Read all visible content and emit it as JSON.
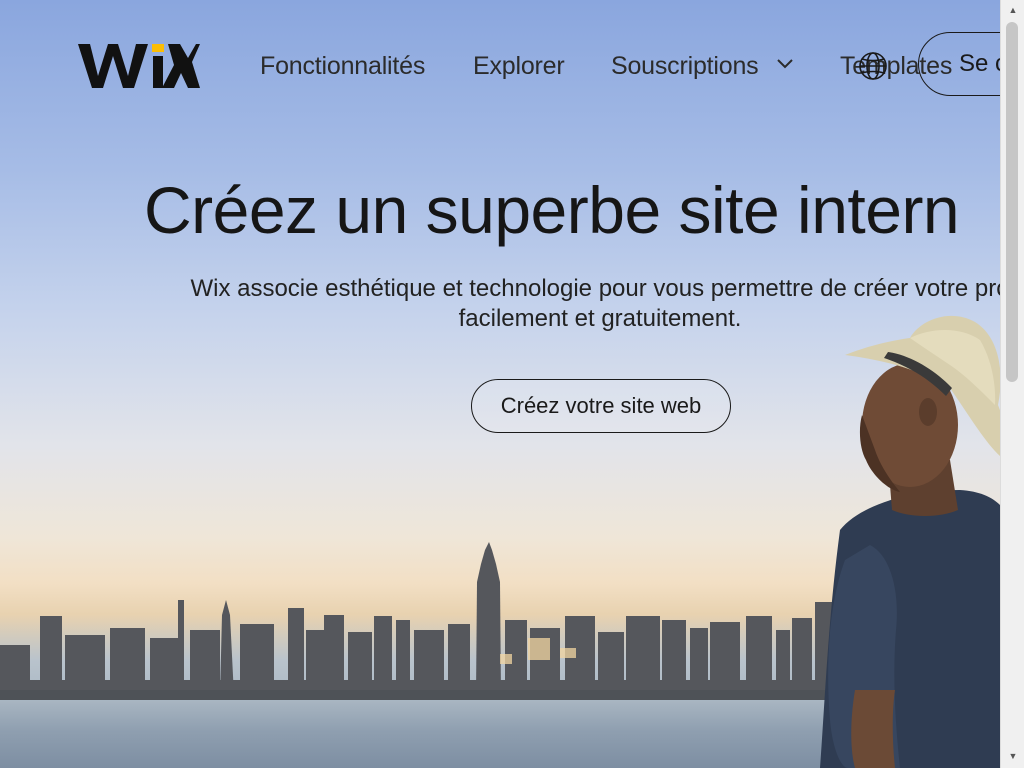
{
  "nav": {
    "logo_text": "WIX",
    "features": "Fonctionnalités",
    "explore": "Explorer",
    "plans": "Souscriptions",
    "templates": "Templates",
    "login": "Se c"
  },
  "hero": {
    "title": "Créez un superbe site intern",
    "subtitle_line1": "Wix associe esthétique et technologie pour vous permettre de créer votre pro",
    "subtitle_line2": "facilement et gratuitement.",
    "cta": "Créez votre site web"
  },
  "icons": {
    "chevron": "chevron-down-icon",
    "globe": "globe-icon"
  },
  "colors": {
    "text": "#161616",
    "logo_dot": "#fbbd05"
  }
}
